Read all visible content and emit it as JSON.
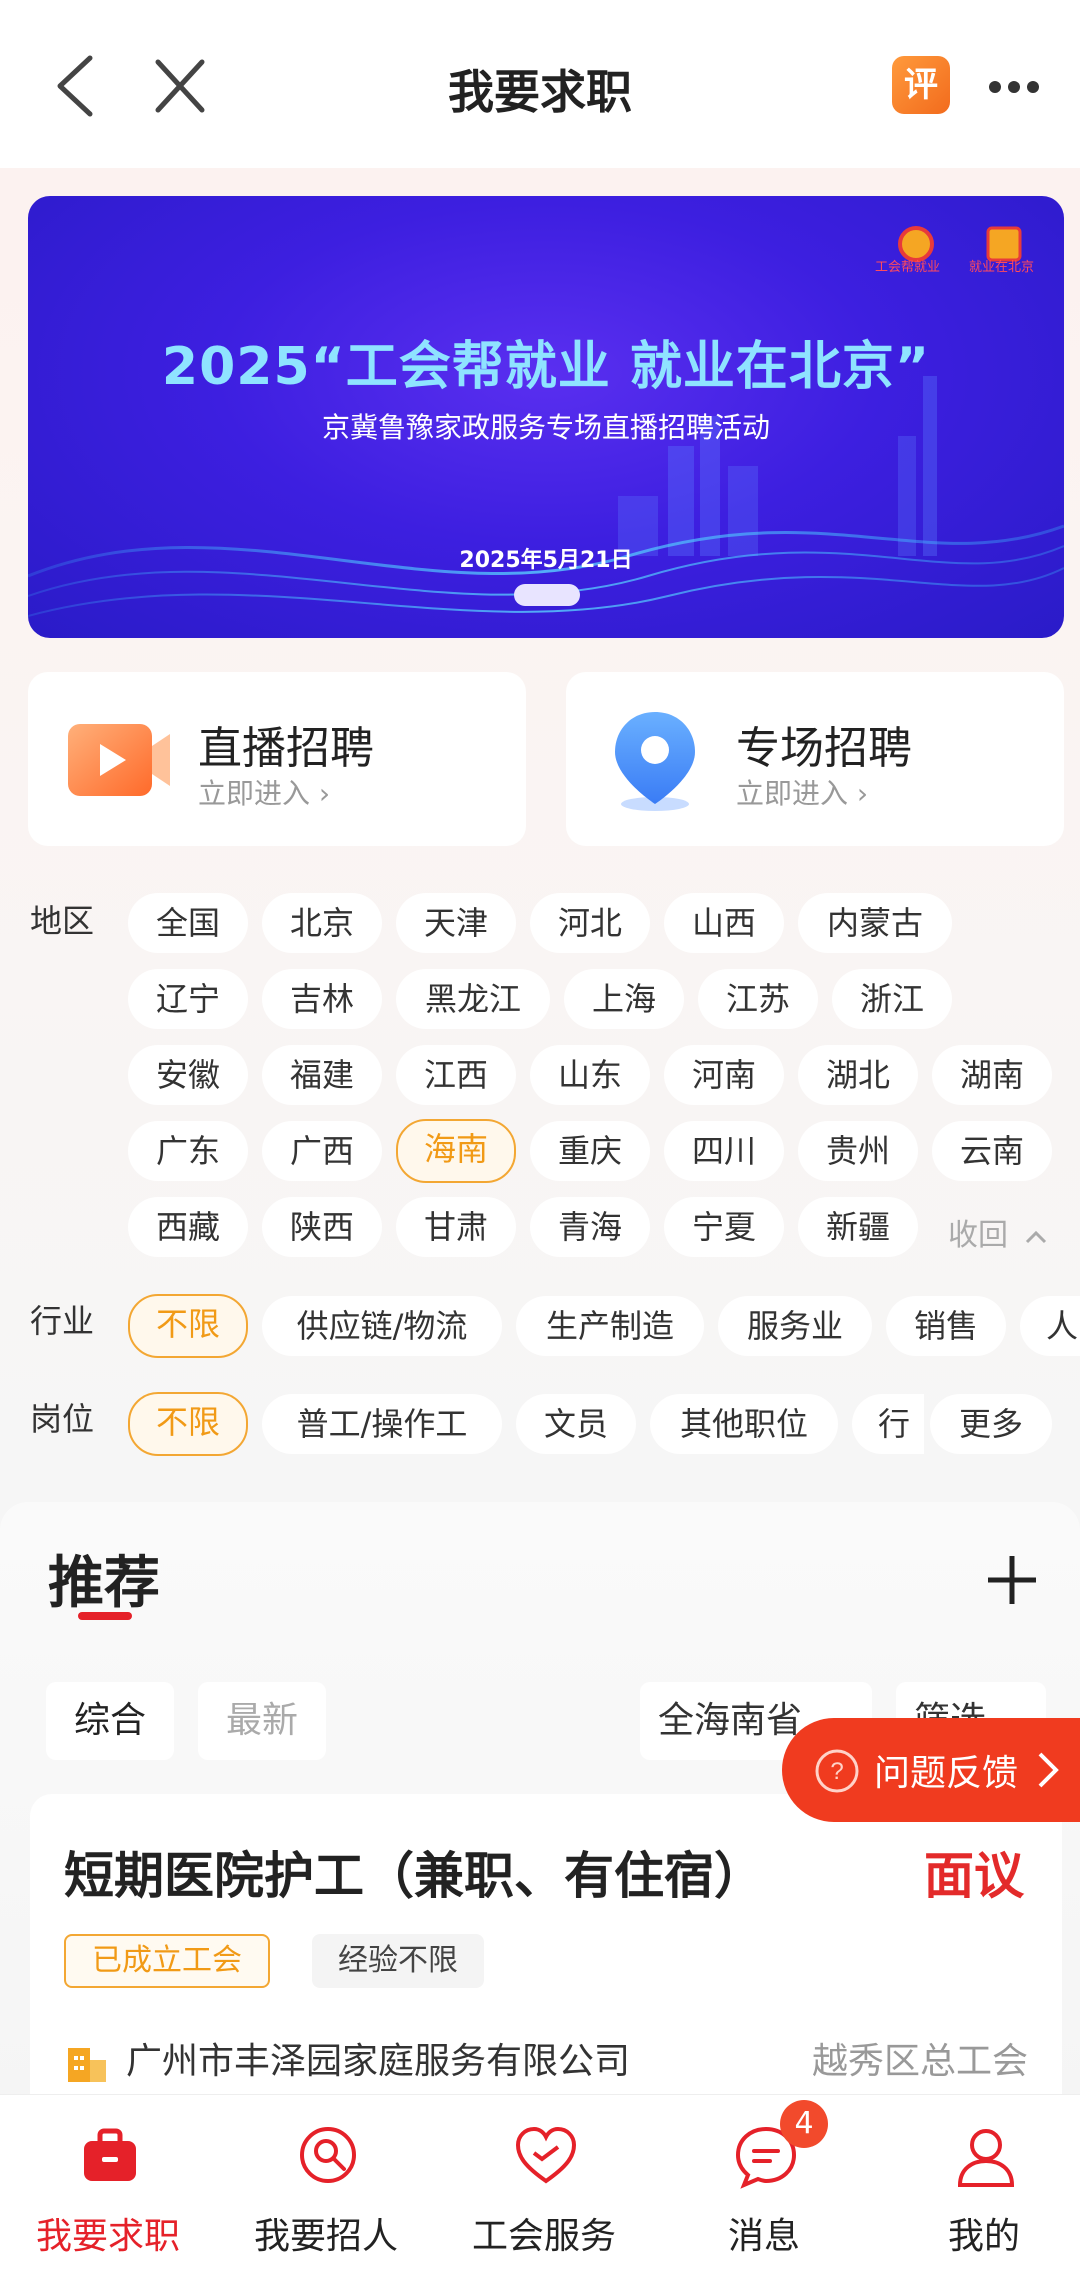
{
  "header": {
    "title": "我要求职",
    "rate_badge": "评"
  },
  "banner": {
    "title": "2025“工会帮就业 就业在北京”",
    "subtitle": "京冀鲁豫家政服务专场直播招聘活动",
    "date": "2025年5月21日",
    "logo_left_text": "工会帮就业",
    "logo_right_text": "就业在北京"
  },
  "entries": [
    {
      "title": "直播招聘",
      "sub": "立即进入 ›"
    },
    {
      "title": "专场招聘",
      "sub": "立即进入 ›"
    }
  ],
  "region": {
    "label": "地区",
    "items": [
      "全国",
      "北京",
      "天津",
      "河北",
      "山西",
      "内蒙古",
      "辽宁",
      "吉林",
      "黑龙江",
      "上海",
      "江苏",
      "浙江",
      "安徽",
      "福建",
      "江西",
      "山东",
      "河南",
      "湖北",
      "湖南",
      "广东",
      "广西",
      "海南",
      "重庆",
      "四川",
      "贵州",
      "云南",
      "西藏",
      "陕西",
      "甘肃",
      "青海",
      "宁夏",
      "新疆"
    ],
    "selected": "海南",
    "collapse": "收回"
  },
  "industry": {
    "label": "行业",
    "items": [
      "不限",
      "供应链/物流",
      "生产制造",
      "服务业",
      "销售",
      "人"
    ]
  },
  "position": {
    "label": "岗位",
    "items": [
      "不限",
      "普工/操作工",
      "文员",
      "其他职位",
      "行",
      "更多"
    ]
  },
  "recommend": {
    "title": "推荐",
    "sort": [
      "综合",
      "最新"
    ],
    "area_filter": "全海南省",
    "screen_filter": "筛选"
  },
  "feedback": {
    "label": "问题反馈"
  },
  "job": {
    "title": "短期医院护工（兼职、有住宿）",
    "salary": "面议",
    "tags": [
      "已成立工会",
      "经验不限"
    ],
    "company": "广州市丰泽园家庭服务有限公司",
    "org": "越秀区总工会"
  },
  "nav": {
    "items": [
      "我要求职",
      "我要招人",
      "工会服务",
      "消息",
      "我的"
    ],
    "badge": "4"
  },
  "colors": {
    "accent_red": "#e52129",
    "accent_orange": "#f19a16",
    "banner_blue": "#3d1fe0"
  }
}
